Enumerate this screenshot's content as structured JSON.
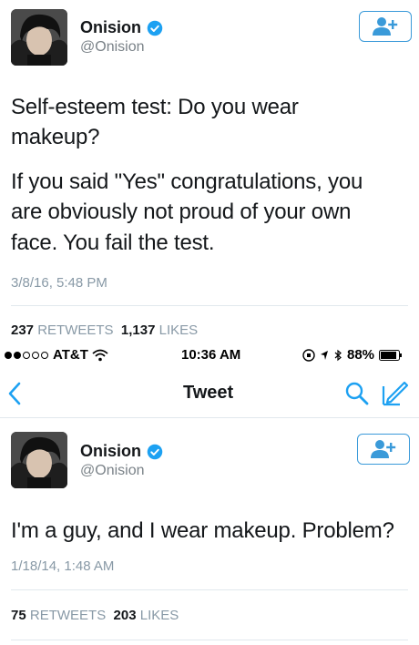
{
  "tweet1": {
    "name": "Onision",
    "handle": "@Onision",
    "text_line1": "Self-esteem test: Do you wear",
    "text_line2": "makeup?",
    "text_line3": "If you said \"Yes\" congratulations, you",
    "text_line4": "are obviously not proud of your own",
    "text_line5": "face. You fail the test.",
    "timestamp": "3/8/16, 5:48 PM",
    "retweets_count": "237",
    "retweets_label": "RETWEETS",
    "likes_count": "1,137",
    "likes_label": "LIKES"
  },
  "status_bar": {
    "carrier": "AT&T",
    "time": "10:36 AM",
    "battery": "88%"
  },
  "nav": {
    "title": "Tweet"
  },
  "tweet2": {
    "name": "Onision",
    "handle": "@Onision",
    "text": "I'm a guy, and I wear makeup. Problem?",
    "timestamp": "1/18/14, 1:48 AM",
    "retweets_count": "75",
    "retweets_label": "RETWEETS",
    "likes_count": "203",
    "likes_label": "LIKES"
  },
  "colors": {
    "accent": "#1da1f2",
    "follow_border": "#3a9ad9",
    "muted": "#8899a6"
  },
  "icons": [
    "verified-badge-icon",
    "follow-person-plus-icon",
    "wifi-icon",
    "bluetooth-icon",
    "battery-icon",
    "back-chevron-icon",
    "search-icon",
    "compose-icon"
  ]
}
